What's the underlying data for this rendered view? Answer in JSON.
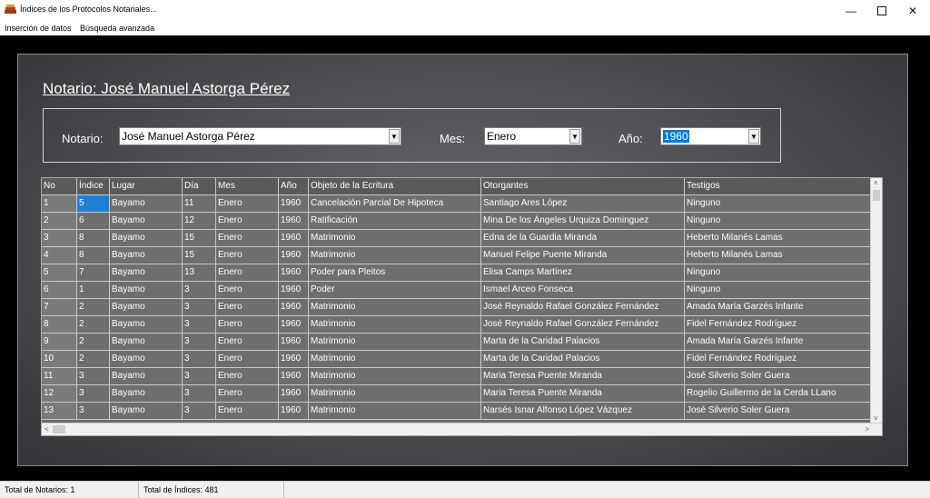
{
  "window": {
    "title": "Índices de los Protocolos Notariales..."
  },
  "menu": [
    "Inserción de datos",
    "Búsqueda avanzada"
  ],
  "heading": "Notario: José Manuel Astorga Pérez",
  "filters": {
    "notario_label": "Notario:",
    "notario_value": "José Manuel Astorga Pérez",
    "mes_label": "Mes:",
    "mes_value": "Enero",
    "anio_label": "Año:",
    "anio_value": "1960"
  },
  "table": {
    "columns": [
      "No",
      "Índice",
      "Lugar",
      "Día",
      "Mes",
      "Año",
      "Objeto de la Ecritura",
      "Otorgantes",
      "Testigos"
    ],
    "rows": [
      [
        "1",
        "5",
        "Bayamo",
        "11",
        "Enero",
        "1960",
        "Cancelación Parcial De Hipoteca",
        "Santiago Ares López",
        "Ninguno"
      ],
      [
        "2",
        "6",
        "Bayamo",
        "12",
        "Enero",
        "1960",
        "Ratificación",
        "Mina De los Ángeles Urquiza Dominguez",
        "Ninguno"
      ],
      [
        "3",
        "8",
        "Bayamo",
        "15",
        "Enero",
        "1960",
        "Matrimonio",
        "Edna de la Guardia Miranda",
        "Heberto Milanés Lamas"
      ],
      [
        "4",
        "8",
        "Bayamo",
        "15",
        "Enero",
        "1960",
        "Matrimonio",
        "Manuel Felipe Puente Miranda",
        "Heberto Milanés Lamas"
      ],
      [
        "5",
        "7",
        "Bayamo",
        "13",
        "Enero",
        "1960",
        "Poder para Pleitos",
        "Elisa Camps Martínez",
        "Ninguno"
      ],
      [
        "6",
        "1",
        "Bayamo",
        "3",
        "Enero",
        "1960",
        "Poder",
        "Ismael Arceo Fonseca",
        "Ninguno"
      ],
      [
        "7",
        "2",
        "Bayamo",
        "3",
        "Enero",
        "1960",
        "Matrimonio",
        "José Reynaldo Rafael González Fernández",
        "Amada María Garzés Infante"
      ],
      [
        "8",
        "2",
        "Bayamo",
        "3",
        "Enero",
        "1960",
        "Matrimonio",
        "José Reynaldo Rafael González Fernández",
        "Fidel Fernández Rodríguez"
      ],
      [
        "9",
        "2",
        "Bayamo",
        "3",
        "Enero",
        "1960",
        "Matrimonio",
        "Marta de la Caridad Palacios",
        "Amada María Garzés Infante"
      ],
      [
        "10",
        "2",
        "Bayamo",
        "3",
        "Enero",
        "1960",
        "Matrimonio",
        "Marta de la Caridad Palacios",
        "Fidel Fernández Rodríguez"
      ],
      [
        "11",
        "3",
        "Bayamo",
        "3",
        "Enero",
        "1960",
        "Matrimonio",
        "Maria Teresa Puente Miranda",
        "José Silverio Soler Guera"
      ],
      [
        "12",
        "3",
        "Bayamo",
        "3",
        "Enero",
        "1960",
        "Matrimonio",
        "Maria Teresa Puente Miranda",
        "Rogelio Guillermo de la Cerda LLano"
      ],
      [
        "13",
        "3",
        "Bayamo",
        "3",
        "Enero",
        "1960",
        "Matrimonio",
        "Narsés Isnar Alfonso López Vázquez",
        "José Silverio Soler Guera"
      ]
    ]
  },
  "status": {
    "notarios": "Total de Notarios: 1",
    "indices": "Total de Índices: 481"
  },
  "colors": {
    "selection": "#1e7fd6",
    "panel_background": "#4c4d50"
  }
}
